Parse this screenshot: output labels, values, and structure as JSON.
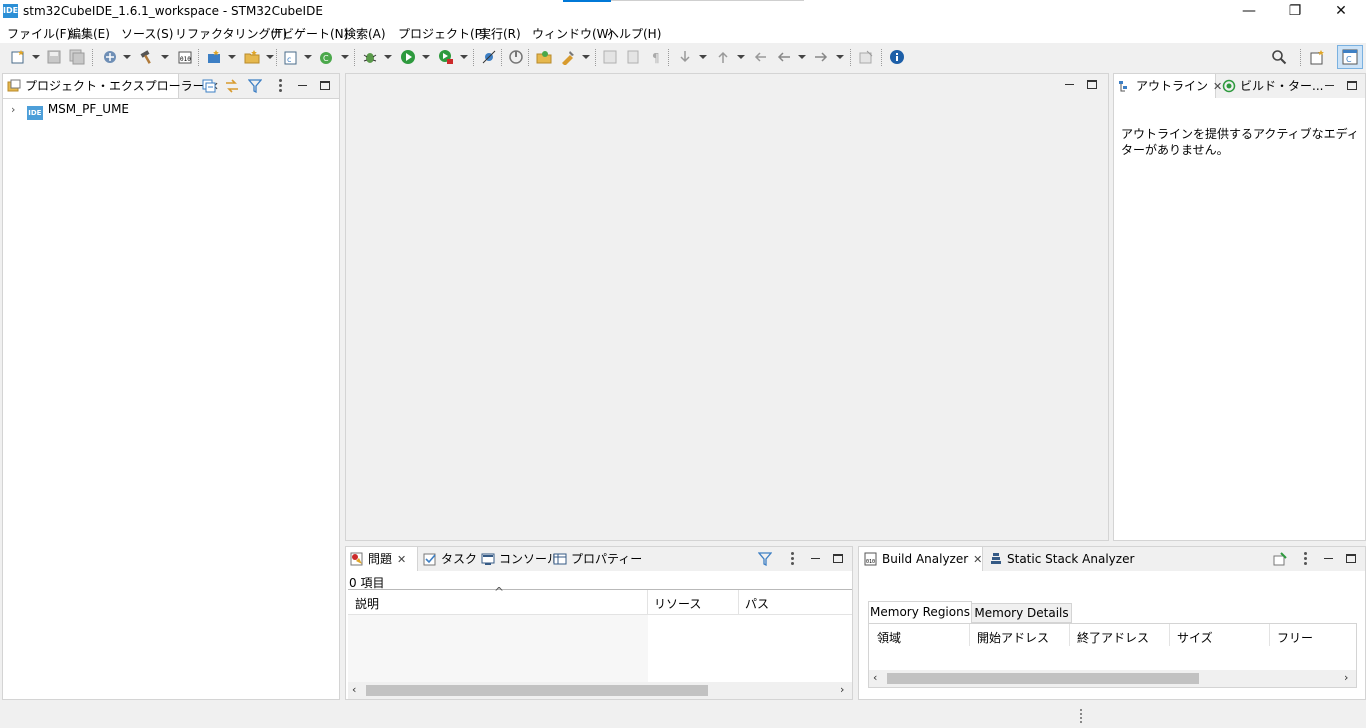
{
  "window": {
    "title": "stm32CubeIDE_1.6.1_workspace - STM32CubeIDE",
    "app_icon_text": "IDE",
    "minimize": "—",
    "restore": "❐",
    "close": "✕"
  },
  "menu": [
    "ファイル(F)",
    "編集(E)",
    "ソース(S)",
    "リファクタリング(T)",
    "ナビゲート(N)",
    "検索(A)",
    "プロジェクト(P)",
    "実行(R)",
    "ウィンドウ(W)",
    "ヘルプ(H)"
  ],
  "project_explorer": {
    "tab_label": "プロジェクト・エクスプローラー",
    "items": [
      {
        "label": "MSM_PF_UME",
        "icon_text": "IDE"
      }
    ]
  },
  "outline": {
    "tab_label": "アウトライン",
    "tab2_label": "ビルド・ター...",
    "message": "アウトラインを提供するアクティブなエディターがありません。"
  },
  "bottom_left": {
    "tabs": [
      "問題",
      "タスク",
      "コンソール",
      "プロパティー"
    ],
    "item_count": "0 項目",
    "columns": [
      "説明",
      "リソース",
      "パス"
    ],
    "sort_indicator": "^"
  },
  "bottom_right": {
    "tabs": [
      "Build Analyzer",
      "Static Stack Analyzer"
    ],
    "subtabs": [
      "Memory Regions",
      "Memory Details"
    ],
    "columns": [
      "領域",
      "開始アドレス",
      "終了アドレス",
      "サイズ",
      "フリー"
    ]
  },
  "colors": {
    "accent": "#0078d7",
    "panel_bg": "#ffffff",
    "chrome_bg": "#f0f0f0",
    "border": "#d4d4d4"
  }
}
